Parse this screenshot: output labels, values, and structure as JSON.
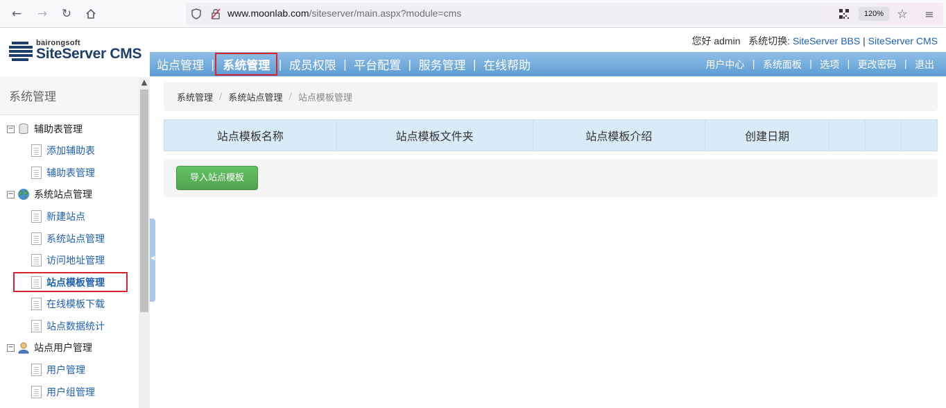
{
  "browser": {
    "url_host": "www.moonlab.com",
    "url_path": "/siteserver/main.aspx?module=cms",
    "zoom": "120%"
  },
  "header": {
    "logo_small": "bairongsoft",
    "logo_big": "SiteServer CMS",
    "greeting": "您好 admin",
    "switch_label": "系统切换: ",
    "switch_bbs": "SiteServer BBS",
    "switch_sep": " | ",
    "switch_cms": "SiteServer CMS"
  },
  "menu": {
    "items": [
      "站点管理",
      "系统管理",
      "成员权限",
      "平台配置",
      "服务管理",
      "在线帮助"
    ],
    "separator": "|",
    "right_items": [
      "用户中心",
      "系统面板",
      "选项",
      "更改密码",
      "退出"
    ]
  },
  "sidebar": {
    "title": "系统管理",
    "groups": [
      {
        "label": "辅助表管理",
        "toggle": "⊟",
        "items": [
          "添加辅助表",
          "辅助表管理"
        ]
      },
      {
        "label": "系统站点管理",
        "toggle": "⊟",
        "items": [
          "新建站点",
          "系统站点管理",
          "访问地址管理",
          "站点模板管理",
          "在线模板下载",
          "站点数据统计"
        ]
      },
      {
        "label": "站点用户管理",
        "toggle": "⊟",
        "items": [
          "用户管理",
          "用户组管理"
        ]
      }
    ]
  },
  "breadcrumb": {
    "items": [
      "系统管理",
      "系统站点管理",
      "站点模板管理"
    ],
    "separator": "/"
  },
  "table": {
    "columns": [
      "站点模板名称",
      "站点模板文件夹",
      "站点模板介绍",
      "创建日期",
      "",
      "",
      ""
    ]
  },
  "actions": {
    "import_button": "导入站点模板"
  },
  "colors": {
    "menu_blue": "#5d9bd3",
    "link_blue": "#1e5fb4",
    "highlight_red": "#d9232f",
    "button_green": "#51a351",
    "table_header": "#d9ebf6"
  }
}
